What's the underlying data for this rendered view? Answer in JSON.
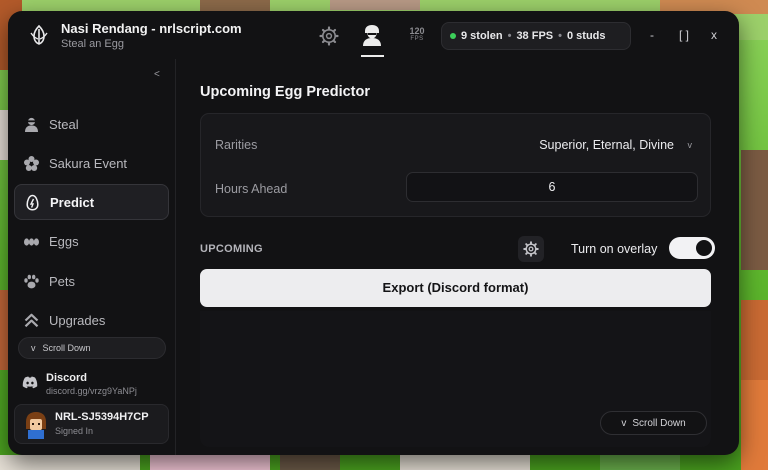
{
  "app": {
    "title": "Nasi Rendang - nrlscript.com",
    "subtitle": "Steal an Egg",
    "logo_icon": "tulip-logo-icon"
  },
  "topbar": {
    "tabs": [
      {
        "name": "settings",
        "icon": "gear-icon"
      },
      {
        "name": "player",
        "icon": "user-icon",
        "active": true
      },
      {
        "name": "fps-cap",
        "icon": "fps-icon",
        "number": "120",
        "label": "FPS"
      }
    ],
    "stats": {
      "status_color": "#3ccf5a",
      "stolen": "9 stolen",
      "fps": "38 FPS",
      "studs": "0 studs",
      "separator": "•"
    },
    "window_buttons": {
      "minimize": "-",
      "maximize": "[ ]",
      "close": "x"
    }
  },
  "sidebar": {
    "collapse_label": "<",
    "items": [
      {
        "label": "Steal",
        "icon": "thief-icon",
        "active": false
      },
      {
        "label": "Sakura Event",
        "icon": "flower-icon",
        "active": false
      },
      {
        "label": "Predict",
        "icon": "egg-icon",
        "active": true
      },
      {
        "label": "Eggs",
        "icon": "eggs-icon",
        "active": false
      },
      {
        "label": "Pets",
        "icon": "paw-icon",
        "active": false
      },
      {
        "label": "Upgrades",
        "icon": "double-chevron-up-icon",
        "active": false
      }
    ],
    "scroll_button": {
      "chevron": "v",
      "label": "Scroll Down"
    },
    "discord": {
      "name": "Discord",
      "link": "discord.gg/vrzg9YaNPj"
    },
    "user": {
      "name": "NRL-SJ5394H7CP",
      "status": "Signed In"
    }
  },
  "main": {
    "title": "Upcoming Egg Predictor",
    "rarities": {
      "label": "Rarities",
      "value": "Superior, Eternal, Divine",
      "chevron": "v"
    },
    "hours": {
      "label": "Hours Ahead",
      "value": "6"
    },
    "upcoming_label": "UPCOMING",
    "overlay": {
      "label": "Turn on overlay",
      "enabled": true
    },
    "export_button": "Export (Discord format)",
    "scroll_button": {
      "chevron": "v",
      "label": "Scroll Down"
    }
  },
  "theme": {
    "window_bg": "#121214",
    "accent_light": "#ededef",
    "game_grass": "#5fb82e"
  }
}
